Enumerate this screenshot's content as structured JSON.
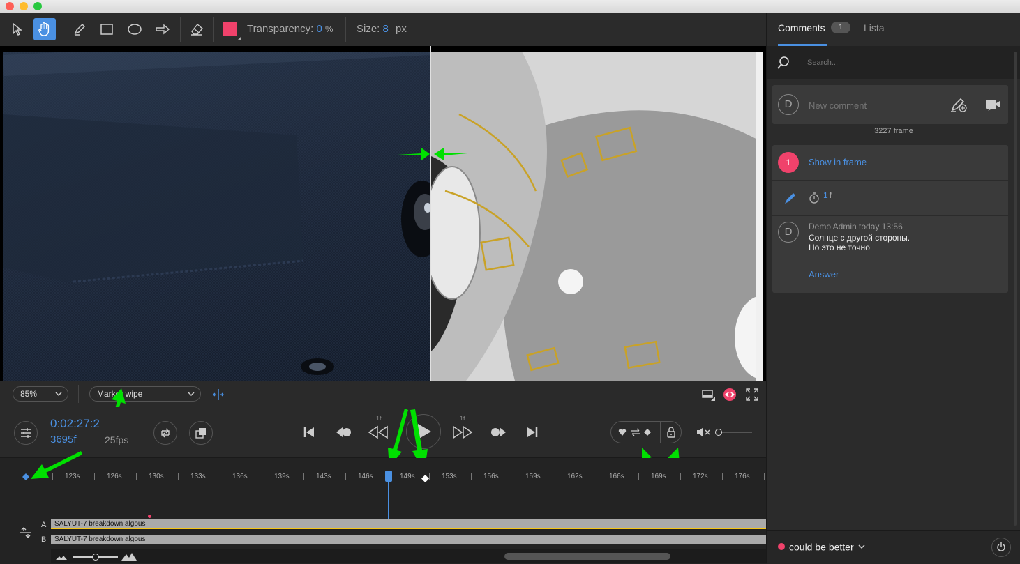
{
  "toolbar": {
    "transparency_label": "Transparency:",
    "transparency_value": "0",
    "transparency_unit": "%",
    "size_label": "Size:",
    "size_value": "8",
    "size_unit": "px",
    "color": "#f0426b"
  },
  "viewer_bar": {
    "zoom": "85%",
    "mode": "Marker wipe"
  },
  "controls": {
    "timecode": "0:02:27:2",
    "frame": "3695f",
    "fps": "25fps",
    "step_back_label": "1f",
    "step_fwd_label": "1f"
  },
  "ruler": {
    "labels": [
      "123s",
      "126s",
      "130s",
      "133s",
      "136s",
      "139s",
      "143s",
      "146s",
      "149s",
      "153s",
      "156s",
      "159s",
      "162s",
      "166s",
      "169s",
      "172s",
      "176s"
    ]
  },
  "tracks": {
    "a_letter": "A",
    "b_letter": "B",
    "a_name": "SALYUT-7 breakdown algous",
    "b_name": "SALYUT-7 breakdown algous"
  },
  "sidebar": {
    "tab_comments": "Comments",
    "tab_comments_count": "1",
    "tab_list": "Lista",
    "search_placeholder": "Search...",
    "avatar_letter": "D",
    "new_comment_placeholder": "New comment",
    "frame_label": "3227 frame",
    "thread": {
      "number": "1",
      "show_in_frame": "Show in frame",
      "duration": "1",
      "duration_unit": "f",
      "author_avatar": "D",
      "author": "Demo Admin",
      "time": "today 13:56",
      "line1": "Солнце с другой стороны.",
      "line2": "Но это не точно",
      "answer": "Answer"
    },
    "status_label": "could be better",
    "status_color": "#f0426b"
  },
  "colors": {
    "accent": "#4a90e2",
    "annotation_arrow": "#00e000"
  }
}
